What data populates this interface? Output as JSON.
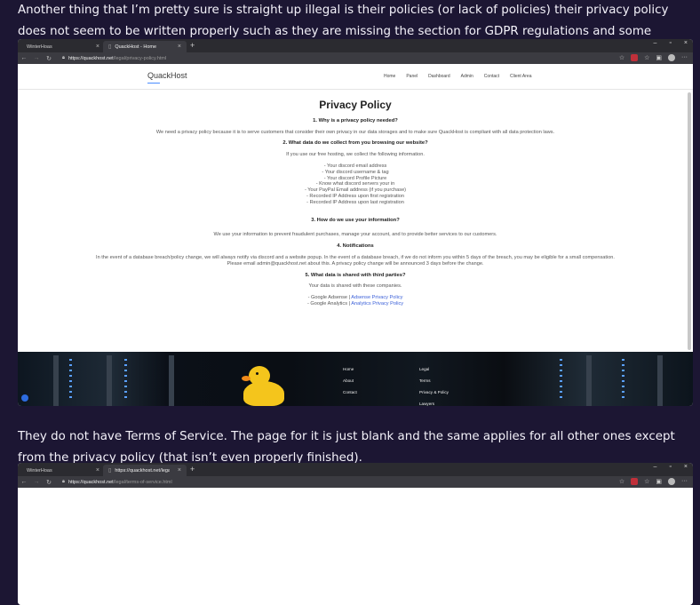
{
  "post": {
    "paragraph1": "Another thing that I’m pretty sure is straight up illegal is their policies (or lack of policies) their privacy policy does not seem to be written properly such as they are missing the section for GDPR regulations and some other important sections",
    "paragraph2": "They do not have Terms of Service. The page for it is just blank and the same applies for all other ones except from the privacy policy (that isn’t even properly finished)."
  },
  "browser1": {
    "tab_inactive": "WinterHoas",
    "tab_active": "QuackHost - Home",
    "url_host": "https://quackhost.net",
    "url_path": "/legal/privacy-policy.html"
  },
  "browser2": {
    "tab_inactive": "WinterHoas",
    "tab_active": "https://quackhost.net/legal/ter...",
    "url_host": "https://quackhost.net",
    "url_path": "/legal/terms-of-service.html"
  },
  "site": {
    "logo": "QuackHost",
    "nav": [
      "Home",
      "Panel",
      "Dashboard",
      "Admin",
      "Contact",
      "Client Area"
    ]
  },
  "policy": {
    "title": "Privacy Policy",
    "s1_heading": "1. Why is a privacy policy needed?",
    "s1_text": "We need a privacy policy because it is to serve customers that consider their own privacy in our data storages and to make sure QuackHost is compliant with all data protection laws.",
    "s2_heading": "2. What data do we collect from you browsing our website?",
    "s2_intro": "If you use our free hosting, we collect the following information.",
    "s2_items": [
      "- Your discord email address",
      "- Your discord username & tag",
      "- Your discord Profile Picture",
      "- Know what discord servers your in",
      "- Your PayPal Email address (if you purchase)",
      "- Recorded IP Address upon first registration",
      "- Recorded IP Address upon last registration"
    ],
    "s3_heading": "3. How do we use your information?",
    "s3_text": "We use your information to prevent fraudulent purchases, manage your account, and to provide better services to our customers.",
    "s4_heading": "4. Notifications",
    "s4_text1": "In the event of a database breach/policy change, we will always notify via discord and a website popup. In the event of a database breach, if we do not inform you within 5 days of the breach, you may be eligible for a small compensation.",
    "s4_text2": "Please email admin@quackhost.net about this. A privacy policy change will be announced 3 days before the change.",
    "s5_heading": "5. What data is shared with third parties?",
    "s5_intro": "Your data is shared with these companies.",
    "s5_line1_prefix": "- Google Adsense | ",
    "s5_line1_link": "Adsense Privacy Policy",
    "s5_line2_prefix": "- Google Analytics | ",
    "s5_line2_link": "Analytics Privacy Policy"
  },
  "footer": {
    "col1": [
      "Home",
      "About",
      "Contact"
    ],
    "col2": [
      "Legal",
      "Terms",
      "Privacy & Policy",
      "Lawyers"
    ]
  }
}
